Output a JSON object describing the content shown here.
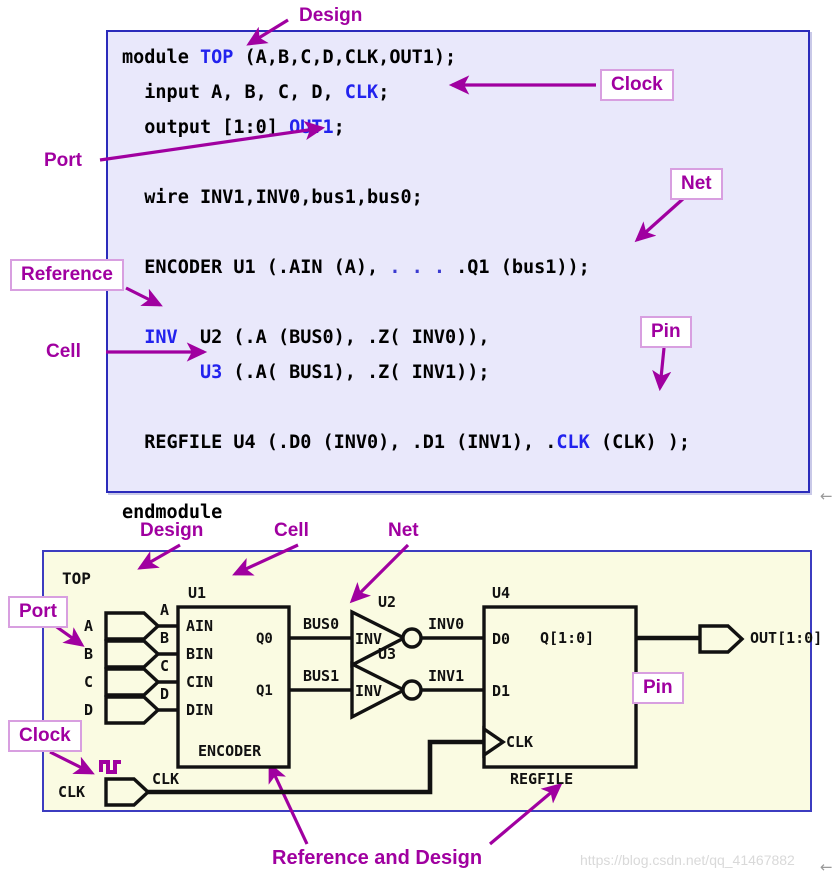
{
  "code": {
    "lines": [
      [
        {
          "t": "module ",
          "c": "plain"
        },
        {
          "t": "TOP",
          "c": "blue"
        },
        {
          "t": " (A,B,C,D,CLK,OUT1);",
          "c": "plain"
        }
      ],
      [
        {
          "t": "  input A, B, C, D, ",
          "c": "plain"
        },
        {
          "t": "CLK",
          "c": "blue"
        },
        {
          "t": ";",
          "c": "plain"
        }
      ],
      [
        {
          "t": "  output [1:0] ",
          "c": "plain"
        },
        {
          "t": "OUT1",
          "c": "blue"
        },
        {
          "t": ";",
          "c": "plain"
        }
      ],
      [],
      [
        {
          "t": "  wire INV1,INV0,bus1,bus0;",
          "c": "plain"
        }
      ],
      [],
      [
        {
          "t": "  ENCODER U1 (.AIN (A), ",
          "c": "plain"
        },
        {
          "t": ". . . ",
          "c": "dots"
        },
        {
          "t": ".Q1 (bus1));",
          "c": "plain"
        }
      ],
      [],
      [
        {
          "t": "  ",
          "c": "plain"
        },
        {
          "t": "INV",
          "c": "blue"
        },
        {
          "t": "  U2 (.A (BUS0), .Z( INV0)),",
          "c": "plain"
        }
      ],
      [
        {
          "t": "       ",
          "c": "plain"
        },
        {
          "t": "U3",
          "c": "blue"
        },
        {
          "t": " (.A( BUS1), .Z( INV1));",
          "c": "plain"
        }
      ],
      [],
      [
        {
          "t": "  REGFILE U4 (.D0 (INV0), .D1 (INV1), .",
          "c": "plain"
        },
        {
          "t": "CLK",
          "c": "blue"
        },
        {
          "t": " (CLK) );",
          "c": "plain"
        }
      ],
      [],
      [
        {
          "t": "endmodule",
          "c": "plain"
        }
      ]
    ]
  },
  "annotations_code": {
    "design": "Design",
    "clock": "Clock",
    "port": "Port",
    "net": "Net",
    "reference": "Reference",
    "cell": "Cell",
    "pin": "Pin"
  },
  "annotations_diagram": {
    "design": "Design",
    "cell": "Cell",
    "net": "Net",
    "port": "Port",
    "pin": "Pin",
    "clock": "Clock",
    "reference_and_design": "Reference and Design"
  },
  "diagram": {
    "top_label": "TOP",
    "input_ports": [
      "A",
      "B",
      "C",
      "D"
    ],
    "input_net_labels": [
      "A",
      "B",
      "C",
      "D"
    ],
    "clock_port": "CLK",
    "clock_net": "CLK",
    "u1": {
      "instance": "U1",
      "reference": "ENCODER",
      "inputs": [
        "AIN",
        "BIN",
        "CIN",
        "DIN"
      ],
      "outputs": [
        "Q0",
        "Q1"
      ]
    },
    "u2": {
      "instance": "U2",
      "reference": "INV",
      "in_net": "BUS0",
      "out_net": "INV0"
    },
    "u3": {
      "instance": "U3",
      "reference": "INV",
      "in_net": "BUS1",
      "out_net": "INV1"
    },
    "u4": {
      "instance": "U4",
      "reference": "REGFILE",
      "inputs": [
        "D0",
        "D1",
        "CLK"
      ],
      "output": "Q[1:0]"
    },
    "output_port": "OUT[1:0]"
  },
  "watermark": "https://blog.csdn.net/qq_41467882",
  "edge_arrow_top": "←",
  "edge_arrow_bottom": "←",
  "colors": {
    "annotation": "#a000a0",
    "code_keyword": "#2222ee",
    "code_bg": "#e9e8fb",
    "code_border": "#2b2bbb",
    "diagram_bg": "#fafbe2",
    "diagram_border": "#3c3cc0",
    "label_box_border": "#d89fe0"
  }
}
